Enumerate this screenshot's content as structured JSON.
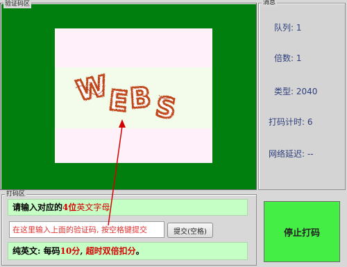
{
  "captcha_panel": {
    "title": "验证码区",
    "captcha_text": "WEBS"
  },
  "info_panel": {
    "title": "消息",
    "queue": "队列: 1",
    "multiplier": "倍数: 1",
    "type": "类型: 2040",
    "timer": "打码计时: 6",
    "latency": "网络延迟: --"
  },
  "input_panel": {
    "title": "打码区",
    "instruction_prefix": "请输入对应的",
    "instruction_count": "4位",
    "instruction_kind": "英文字母",
    "answer_value": "",
    "answer_placeholder": "在这里输入上面的验证码, 按空格键提交",
    "submit_label": "提交(空格)",
    "rule_prefix": "纯英文: 每码",
    "rule_points": "10分",
    "rule_sep": ", ",
    "rule_penalty": "超时双倍扣分",
    "rule_end": "。"
  },
  "stop_button": {
    "label": "停止打码"
  },
  "colors": {
    "captcha_bg": "#007f0e",
    "stop_button": "#44ee44",
    "highlight_red": "#d40000",
    "info_text": "#2e3f7c"
  }
}
